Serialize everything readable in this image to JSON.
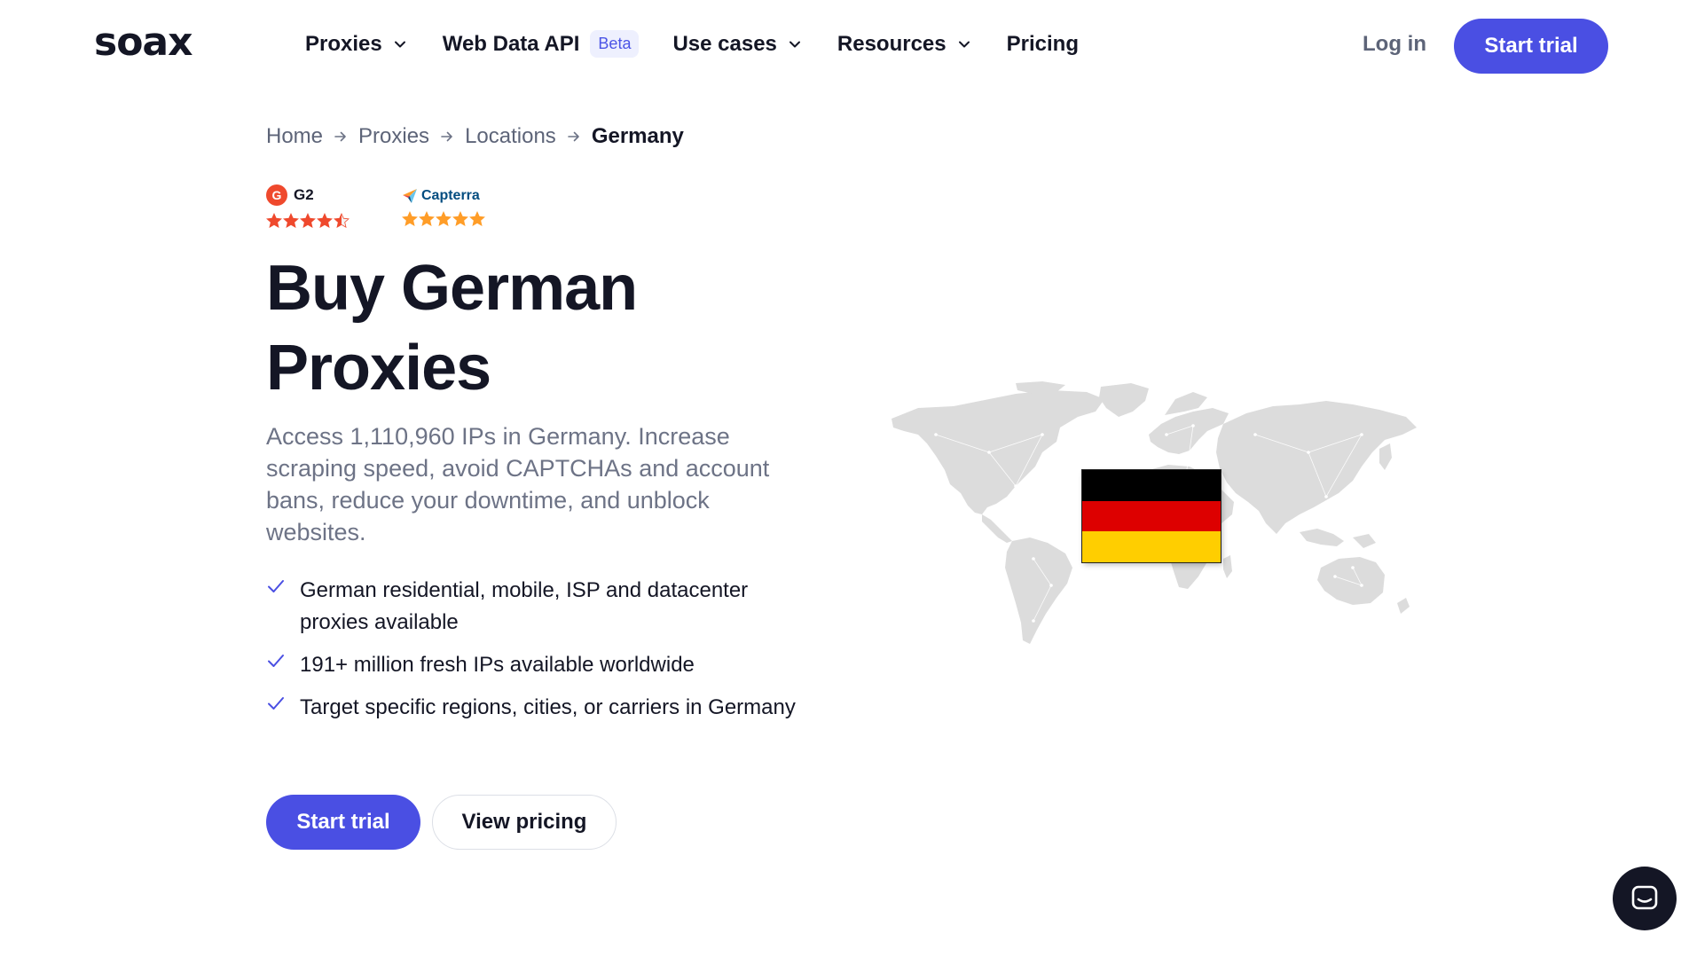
{
  "header": {
    "logo": "soax",
    "nav": [
      {
        "label": "Proxies"
      },
      {
        "label": "Web Data API",
        "badge": "Beta"
      },
      {
        "label": "Use cases"
      },
      {
        "label": "Resources"
      },
      {
        "label": "Pricing"
      }
    ],
    "login_label": "Log in",
    "trial_label": "Start trial"
  },
  "breadcrumb": [
    "Home",
    "Proxies",
    "Locations",
    "Germany"
  ],
  "ratings": {
    "g2": {
      "label": "G2",
      "logo_text": "G",
      "stars": 4.5
    },
    "capterra": {
      "label": "Capterra",
      "stars": 5
    }
  },
  "hero": {
    "title_line1": "Buy German",
    "title_line2": "Proxies",
    "subtitle": "Access 1,110,960 IPs in Germany. Increase scraping speed, avoid CAPTCHAs and account bans, reduce your downtime, and unblock websites.",
    "features": [
      "German residential, mobile, ISP and datacenter proxies available",
      "191+ million fresh IPs available worldwide",
      "Target specific regions, cities, or carriers in Germany"
    ],
    "primary_cta": "Start trial",
    "secondary_cta": "View pricing"
  },
  "flag": {
    "stripes": [
      "#000000",
      "#dd0000",
      "#ffce00"
    ]
  },
  "colors": {
    "accent": "#4a4fe3",
    "text": "#141625",
    "muted": "#6d7386",
    "map_land": "#dcdcdc"
  },
  "icons": {
    "chat": "chat-bubble-icon",
    "check": "check-icon",
    "chevron": "chevron-down-icon",
    "arrow": "arrow-right-icon"
  }
}
